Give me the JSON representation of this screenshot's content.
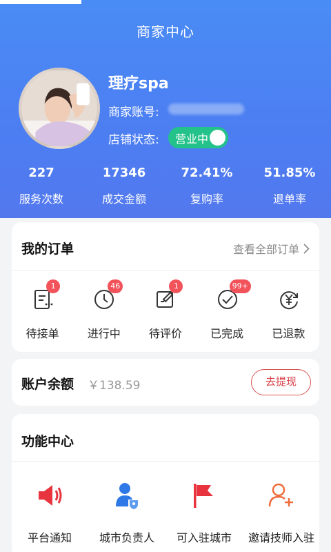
{
  "header": {
    "title": "商家中心",
    "shop_name": "理疗spa",
    "account_label": "商家账号:",
    "status_label": "店铺状态:",
    "status_toggle": "营业中"
  },
  "stats": [
    {
      "value": "227",
      "label": "服务次数"
    },
    {
      "value": "17346",
      "label": "成交金额"
    },
    {
      "value": "72.41%",
      "label": "复购率"
    },
    {
      "value": "51.85%",
      "label": "退单率"
    }
  ],
  "orders": {
    "title": "我的订单",
    "view_all": "查看全部订单",
    "items": [
      {
        "label": "待接单",
        "badge": "1",
        "icon": "pending-order-icon"
      },
      {
        "label": "进行中",
        "badge": "46",
        "icon": "clock-icon"
      },
      {
        "label": "待评价",
        "badge": "1",
        "icon": "edit-review-icon"
      },
      {
        "label": "已完成",
        "badge": "99+",
        "icon": "check-circle-icon"
      },
      {
        "label": "已退款",
        "badge": "",
        "icon": "refund-yen-icon"
      }
    ]
  },
  "balance": {
    "title": "账户余额",
    "amount": "￥138.59",
    "withdraw": "去提现"
  },
  "functions": {
    "title": "功能中心",
    "items": [
      {
        "label": "平台通知",
        "icon": "speaker-icon",
        "color": "#e8343e"
      },
      {
        "label": "城市负责人",
        "icon": "city-manager-icon",
        "color": "#2f78e8"
      },
      {
        "label": "可入驻城市",
        "icon": "flag-icon",
        "color": "#e8343e"
      },
      {
        "label": "邀请技师入驻",
        "icon": "invite-user-icon",
        "color": "#ef6b3a"
      }
    ]
  },
  "colors": {
    "header": "#4a8cf5",
    "toggle": "#23c28a",
    "badge": "#f2525a",
    "accent_red": "#d9434a"
  }
}
